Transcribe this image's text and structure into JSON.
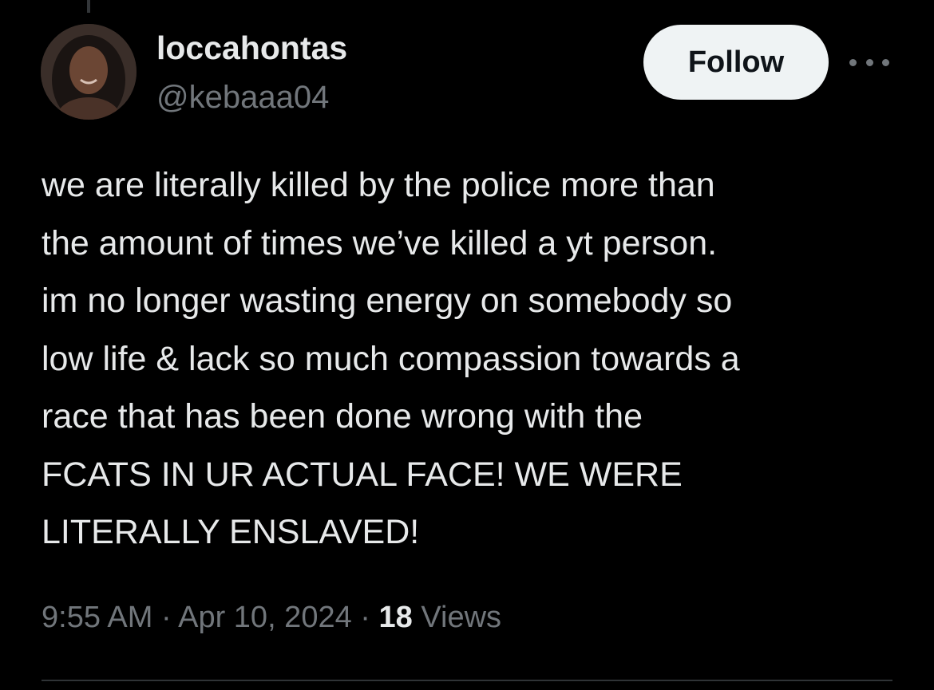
{
  "author": {
    "display_name": "loccahontas",
    "handle": "@kebaaa04",
    "avatar_icon": "profile-photo"
  },
  "actions": {
    "follow_label": "Follow",
    "more_icon": "more-horizontal-icon"
  },
  "tweet": {
    "lines": [
      "we are literally killed by the police more than",
      "the amount of times we’ve killed a yt person.",
      "im no longer wasting energy on somebody so",
      "low life & lack so much compassion towards a",
      "race that has been done wrong with the",
      "FCATS IN UR ACTUAL FACE! WE WERE",
      "LITERALLY ENSLAVED!"
    ]
  },
  "meta": {
    "time": "9:55 AM",
    "separator": " · ",
    "date": "Apr 10, 2024",
    "views_count": "18",
    "views_label": " Views"
  },
  "colors": {
    "background": "#000000",
    "primary_text": "#e7e9ea",
    "secondary_text": "#71767b",
    "follow_bg": "#eff3f4",
    "divider": "#2f3336"
  }
}
